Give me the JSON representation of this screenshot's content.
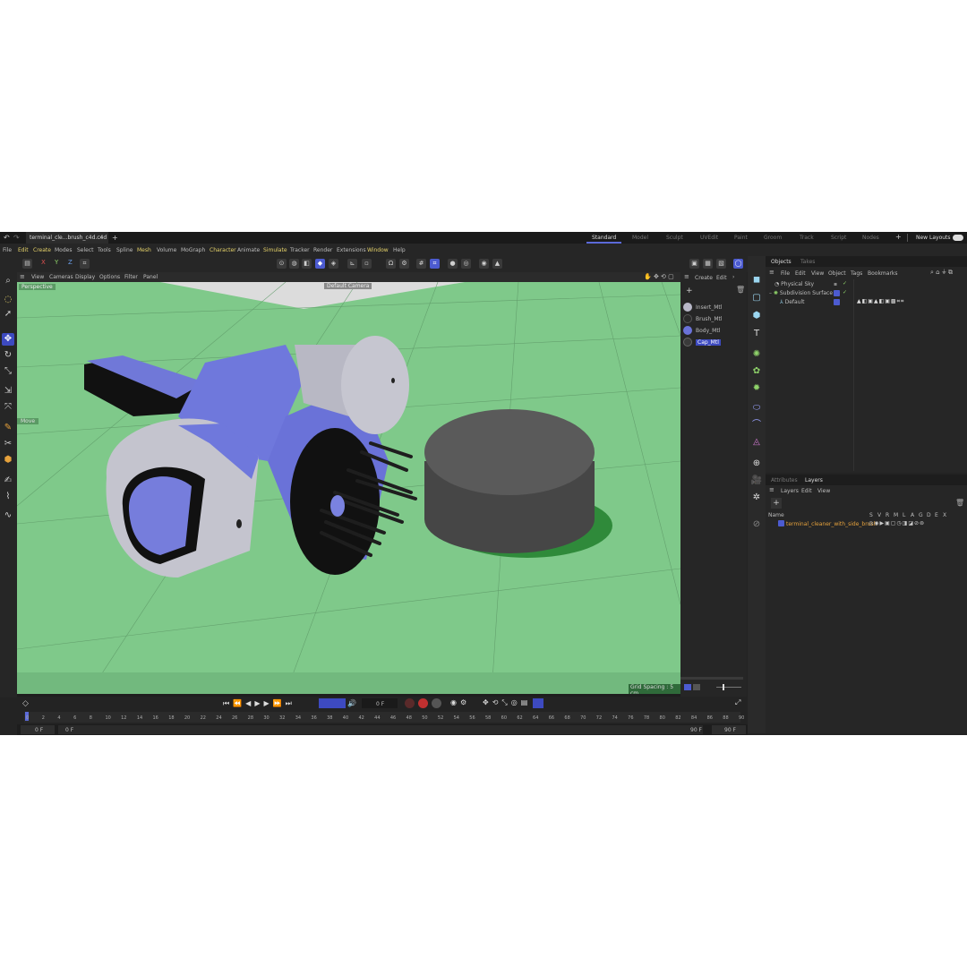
{
  "file_tab": {
    "name": "terminal_cle...brush_c4d.c4d",
    "close": "x",
    "add": "+"
  },
  "layouts": [
    "Standard",
    "Model",
    "Sculpt",
    "UVEdit",
    "Paint",
    "Groom",
    "Track",
    "Script",
    "Nodes"
  ],
  "layout_add": "+",
  "new_layouts": "New Layouts",
  "menu": [
    "File",
    "Edit",
    "Create",
    "Modes",
    "Select",
    "Tools",
    "Spline",
    "Mesh",
    "Volume",
    "MoGraph",
    "Character",
    "Animate",
    "Simulate",
    "Tracker",
    "Render",
    "Extensions",
    "Window",
    "Help"
  ],
  "toolbar": {
    "axis_x": "X",
    "axis_y": "Y",
    "axis_z": "Z"
  },
  "viewport": {
    "menu": [
      "View",
      "Cameras",
      "Display",
      "Options",
      "Filter",
      "Panel"
    ],
    "name": "Perspective",
    "camera": "Default Camera",
    "grid_spacing": "Grid Spacing : 5 cm",
    "move_label": "Move"
  },
  "materials": {
    "menu": [
      "Create",
      "Edit"
    ],
    "items": [
      {
        "label": "Insert_Mtl",
        "color": "#b8b8c8"
      },
      {
        "label": "Brush_Mtl",
        "color": "#2a2a2a"
      },
      {
        "label": "Body_Mtl",
        "color": "#6a72d8"
      },
      {
        "label": "Cap_Mtl",
        "color": "#3a3a3a"
      }
    ]
  },
  "objects": {
    "tabs": [
      "Objects",
      "Takes"
    ],
    "menu": [
      "File",
      "Edit",
      "View",
      "Object",
      "Tags",
      "Bookmarks"
    ],
    "rows": [
      {
        "label": "Physical Sky"
      },
      {
        "label": "Subdivision Surface"
      },
      {
        "label": "Default"
      }
    ]
  },
  "layers": {
    "tabs": [
      "Attributes",
      "Layers"
    ],
    "menu": [
      "Layers",
      "Edit",
      "View"
    ],
    "column_name": "Name",
    "columns": [
      "S",
      "V",
      "R",
      "M",
      "L",
      "A",
      "G",
      "D",
      "E",
      "X"
    ],
    "row": "terminal_cleaner_with_side_brush"
  },
  "timeline": {
    "ticks": [
      "0",
      "2",
      "4",
      "6",
      "8",
      "10",
      "12",
      "14",
      "16",
      "18",
      "20",
      "22",
      "24",
      "26",
      "28",
      "30",
      "32",
      "34",
      "36",
      "38",
      "40",
      "42",
      "44",
      "46",
      "48",
      "50",
      "52",
      "54",
      "56",
      "58",
      "60",
      "62",
      "64",
      "66",
      "68",
      "70",
      "72",
      "74",
      "76",
      "78",
      "80",
      "82",
      "84",
      "86",
      "88",
      "90"
    ],
    "current_frame": "0 F",
    "start": "0 F",
    "range_start": "0 F",
    "range_end": "90 F",
    "end": "90 F"
  },
  "colors": {
    "accent": "#4c5bd0",
    "viewport_bg": "#7fc98a",
    "highlight_menu": "#e6d36a",
    "layer_name": "#e6a23c"
  }
}
